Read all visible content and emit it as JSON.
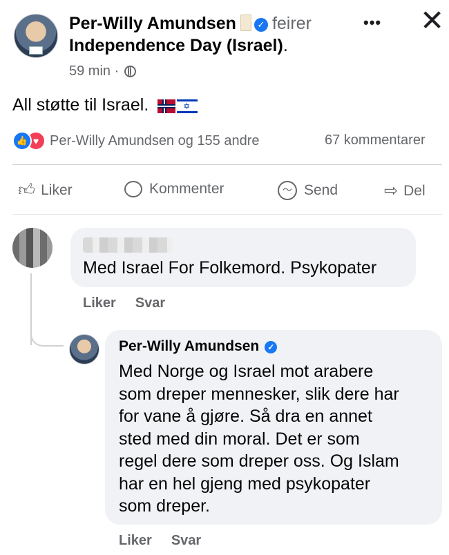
{
  "post": {
    "author": "Per-Willy Amundsen",
    "feeling": "feirer",
    "event": "Independence Day (Israel)",
    "event_suffix": ".",
    "time": "59 min ·",
    "text": "All støtte til Israel.",
    "reactions_text": "Per-Willy Amundsen og 155 andre",
    "comments_count": "67 kommentarer"
  },
  "actions": {
    "like": "Liker",
    "comment": "Kommenter",
    "send": "Send",
    "share": "Del"
  },
  "comment": {
    "text": "Med Israel For Folkemord. Psykopater",
    "like": "Liker",
    "reply": "Svar"
  },
  "reply": {
    "author": "Per-Willy Amundsen",
    "text": "Med Norge og Israel mot arabere\nsom dreper mennesker, slik dere har\nfor vane å gjøre. Så dra en annet\nsted med din moral. Det er som\nregel dere som dreper oss. Og Islam\nhar en hel gjeng med psykopater\nsom dreper.",
    "like": "Liker",
    "reply": "Svar"
  },
  "colors": {
    "accent": "#1877f2",
    "love": "#f33e58",
    "muted": "#65676b",
    "bubble": "#f0f2f5"
  },
  "icons": [
    "more-icon",
    "close-icon",
    "globe-icon",
    "verified-icon",
    "like-icon",
    "comment-icon",
    "messenger-icon",
    "share-icon"
  ]
}
